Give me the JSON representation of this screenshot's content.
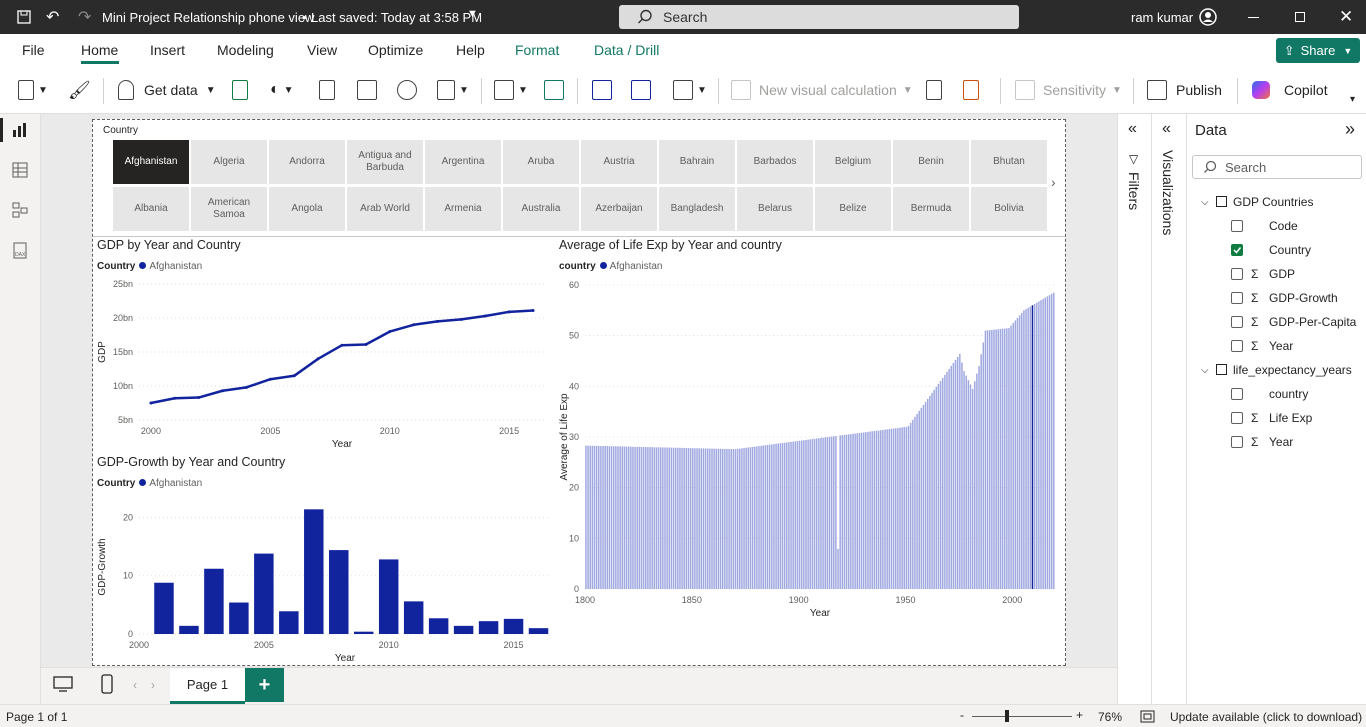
{
  "titlebar": {
    "file_title": "Mini Project Relationship phone view",
    "saved_status": "Last saved: Today at 3:58 PM",
    "search_placeholder": "Search",
    "user": "ram kumar"
  },
  "ribbon": {
    "tabs": [
      "File",
      "Home",
      "Insert",
      "Modeling",
      "View",
      "Optimize",
      "Help",
      "Format",
      "Data / Drill"
    ],
    "active_tab": "Home",
    "share_label": "Share",
    "get_data_label": "Get data",
    "new_visual_calc_label": "New visual calculation",
    "sensitivity_label": "Sensitivity",
    "publish_label": "Publish",
    "copilot_label": "Copilot"
  },
  "slicer": {
    "title": "Country",
    "selected": "Afghanistan",
    "row1": [
      "Afghanistan",
      "Algeria",
      "Andorra",
      "Antigua and Barbuda",
      "Argentina",
      "Aruba",
      "Austria",
      "Bahrain",
      "Barbados",
      "Belgium",
      "Benin",
      "Bhutan"
    ],
    "row2": [
      "Albania",
      "American Samoa",
      "Angola",
      "Arab World",
      "Armenia",
      "Australia",
      "Azerbaijan",
      "Bangladesh",
      "Belarus",
      "Belize",
      "Bermuda",
      "Bolivia"
    ]
  },
  "visuals": {
    "gdp": {
      "title": "GDP by Year and Country",
      "legend_label": "Country",
      "legend_item": "Afghanistan"
    },
    "growth": {
      "title": "GDP-Growth by Year and Country",
      "legend_label": "Country",
      "legend_item": "Afghanistan"
    },
    "life": {
      "title": "Average of Life Exp by Year and country",
      "legend_label": "country",
      "legend_item": "Afghanistan"
    }
  },
  "chart_data": [
    {
      "type": "line",
      "title": "GDP by Year and Country",
      "xlabel": "Year",
      "ylabel": "GDP",
      "series": [
        {
          "name": "Afghanistan",
          "color": "#12239e",
          "x": [
            2000,
            2001,
            2002,
            2003,
            2004,
            2005,
            2006,
            2007,
            2008,
            2009,
            2010,
            2011,
            2012,
            2013,
            2014,
            2015,
            2016
          ],
          "values": [
            7.5,
            8.2,
            8.3,
            9.3,
            9.8,
            11.0,
            11.5,
            14.0,
            16.0,
            16.1,
            18.0,
            19.0,
            19.5,
            19.8,
            20.3,
            20.9,
            21.1
          ]
        }
      ],
      "xlim": [
        1999.5,
        2016.5
      ],
      "ylim": [
        5,
        25
      ],
      "xticks": [
        2000,
        2005,
        2010,
        2015
      ],
      "yticks": [
        5,
        10,
        15,
        20,
        25
      ],
      "ytick_labels": [
        "5bn",
        "10bn",
        "15bn",
        "20bn",
        "25bn"
      ]
    },
    {
      "type": "bar",
      "title": "GDP-Growth by Year and Country",
      "xlabel": "Year",
      "ylabel": "GDP-Growth",
      "series": [
        {
          "name": "Afghanistan",
          "color": "#12239e",
          "x": [
            2001,
            2002,
            2003,
            2004,
            2005,
            2006,
            2007,
            2008,
            2009,
            2010,
            2011,
            2012,
            2013,
            2014,
            2015,
            2016
          ],
          "values": [
            8.8,
            1.4,
            11.2,
            5.4,
            13.8,
            3.9,
            21.4,
            14.4,
            0.4,
            12.8,
            5.6,
            2.7,
            1.4,
            2.2,
            2.6,
            1.0
          ]
        }
      ],
      "xlim": [
        2000,
        2016.5
      ],
      "ylim": [
        0,
        23
      ],
      "xticks": [
        2000,
        2005,
        2010,
        2015
      ],
      "yticks": [
        0,
        10,
        20
      ]
    },
    {
      "type": "bar",
      "title": "Average of Life Exp by Year and country",
      "xlabel": "Year",
      "ylabel": "Average of Life Exp",
      "series": [
        {
          "name": "Afghanistan",
          "color": "#a0a8e0",
          "highlight_color": "#12239e",
          "x_range": [
            1800,
            2020
          ],
          "highlight_year": 2009,
          "keypoints": [
            [
              1800,
              28.3
            ],
            [
              1870,
              27.6
            ],
            [
              1917,
              30.2
            ],
            [
              1918,
              7.9
            ],
            [
              1919,
              30.3
            ],
            [
              1950,
              32.0
            ],
            [
              1951,
              32.2
            ],
            [
              1975,
              46.4
            ],
            [
              1977,
              43.0
            ],
            [
              1981,
              39.5
            ],
            [
              1984,
              44.0
            ],
            [
              1987,
              51.0
            ],
            [
              1998,
              51.5
            ],
            [
              2005,
              55.0
            ],
            [
              2019,
              58.5
            ]
          ]
        }
      ],
      "xlim": [
        1800,
        2020
      ],
      "ylim": [
        0,
        60
      ],
      "xticks": [
        1800,
        1850,
        1900,
        1950,
        2000
      ],
      "yticks": [
        0,
        10,
        20,
        30,
        40,
        50,
        60
      ]
    }
  ],
  "panes": {
    "filters_label": "Filters",
    "visualizations_label": "Visualizations",
    "data_label": "Data",
    "search_placeholder": "Search",
    "tables": [
      {
        "name": "GDP Countries",
        "fields": [
          {
            "name": "Code",
            "sigma": false,
            "checked": false
          },
          {
            "name": "Country",
            "sigma": false,
            "checked": true
          },
          {
            "name": "GDP",
            "sigma": true,
            "checked": false
          },
          {
            "name": "GDP-Growth",
            "sigma": true,
            "checked": false
          },
          {
            "name": "GDP-Per-Capita",
            "sigma": true,
            "checked": false
          },
          {
            "name": "Year",
            "sigma": true,
            "checked": false
          }
        ]
      },
      {
        "name": "life_expectancy_years",
        "fields": [
          {
            "name": "country",
            "sigma": false,
            "checked": false
          },
          {
            "name": "Life Exp",
            "sigma": true,
            "checked": false
          },
          {
            "name": "Year",
            "sigma": true,
            "checked": false
          }
        ]
      }
    ]
  },
  "pages": {
    "current": "Page 1"
  },
  "status": {
    "page_info": "Page 1 of 1",
    "zoom": "76%",
    "update": "Update available (click to download)"
  },
  "colors": {
    "accent": "#117865",
    "series": "#12239e",
    "title_bar": "#2b2b2b"
  }
}
